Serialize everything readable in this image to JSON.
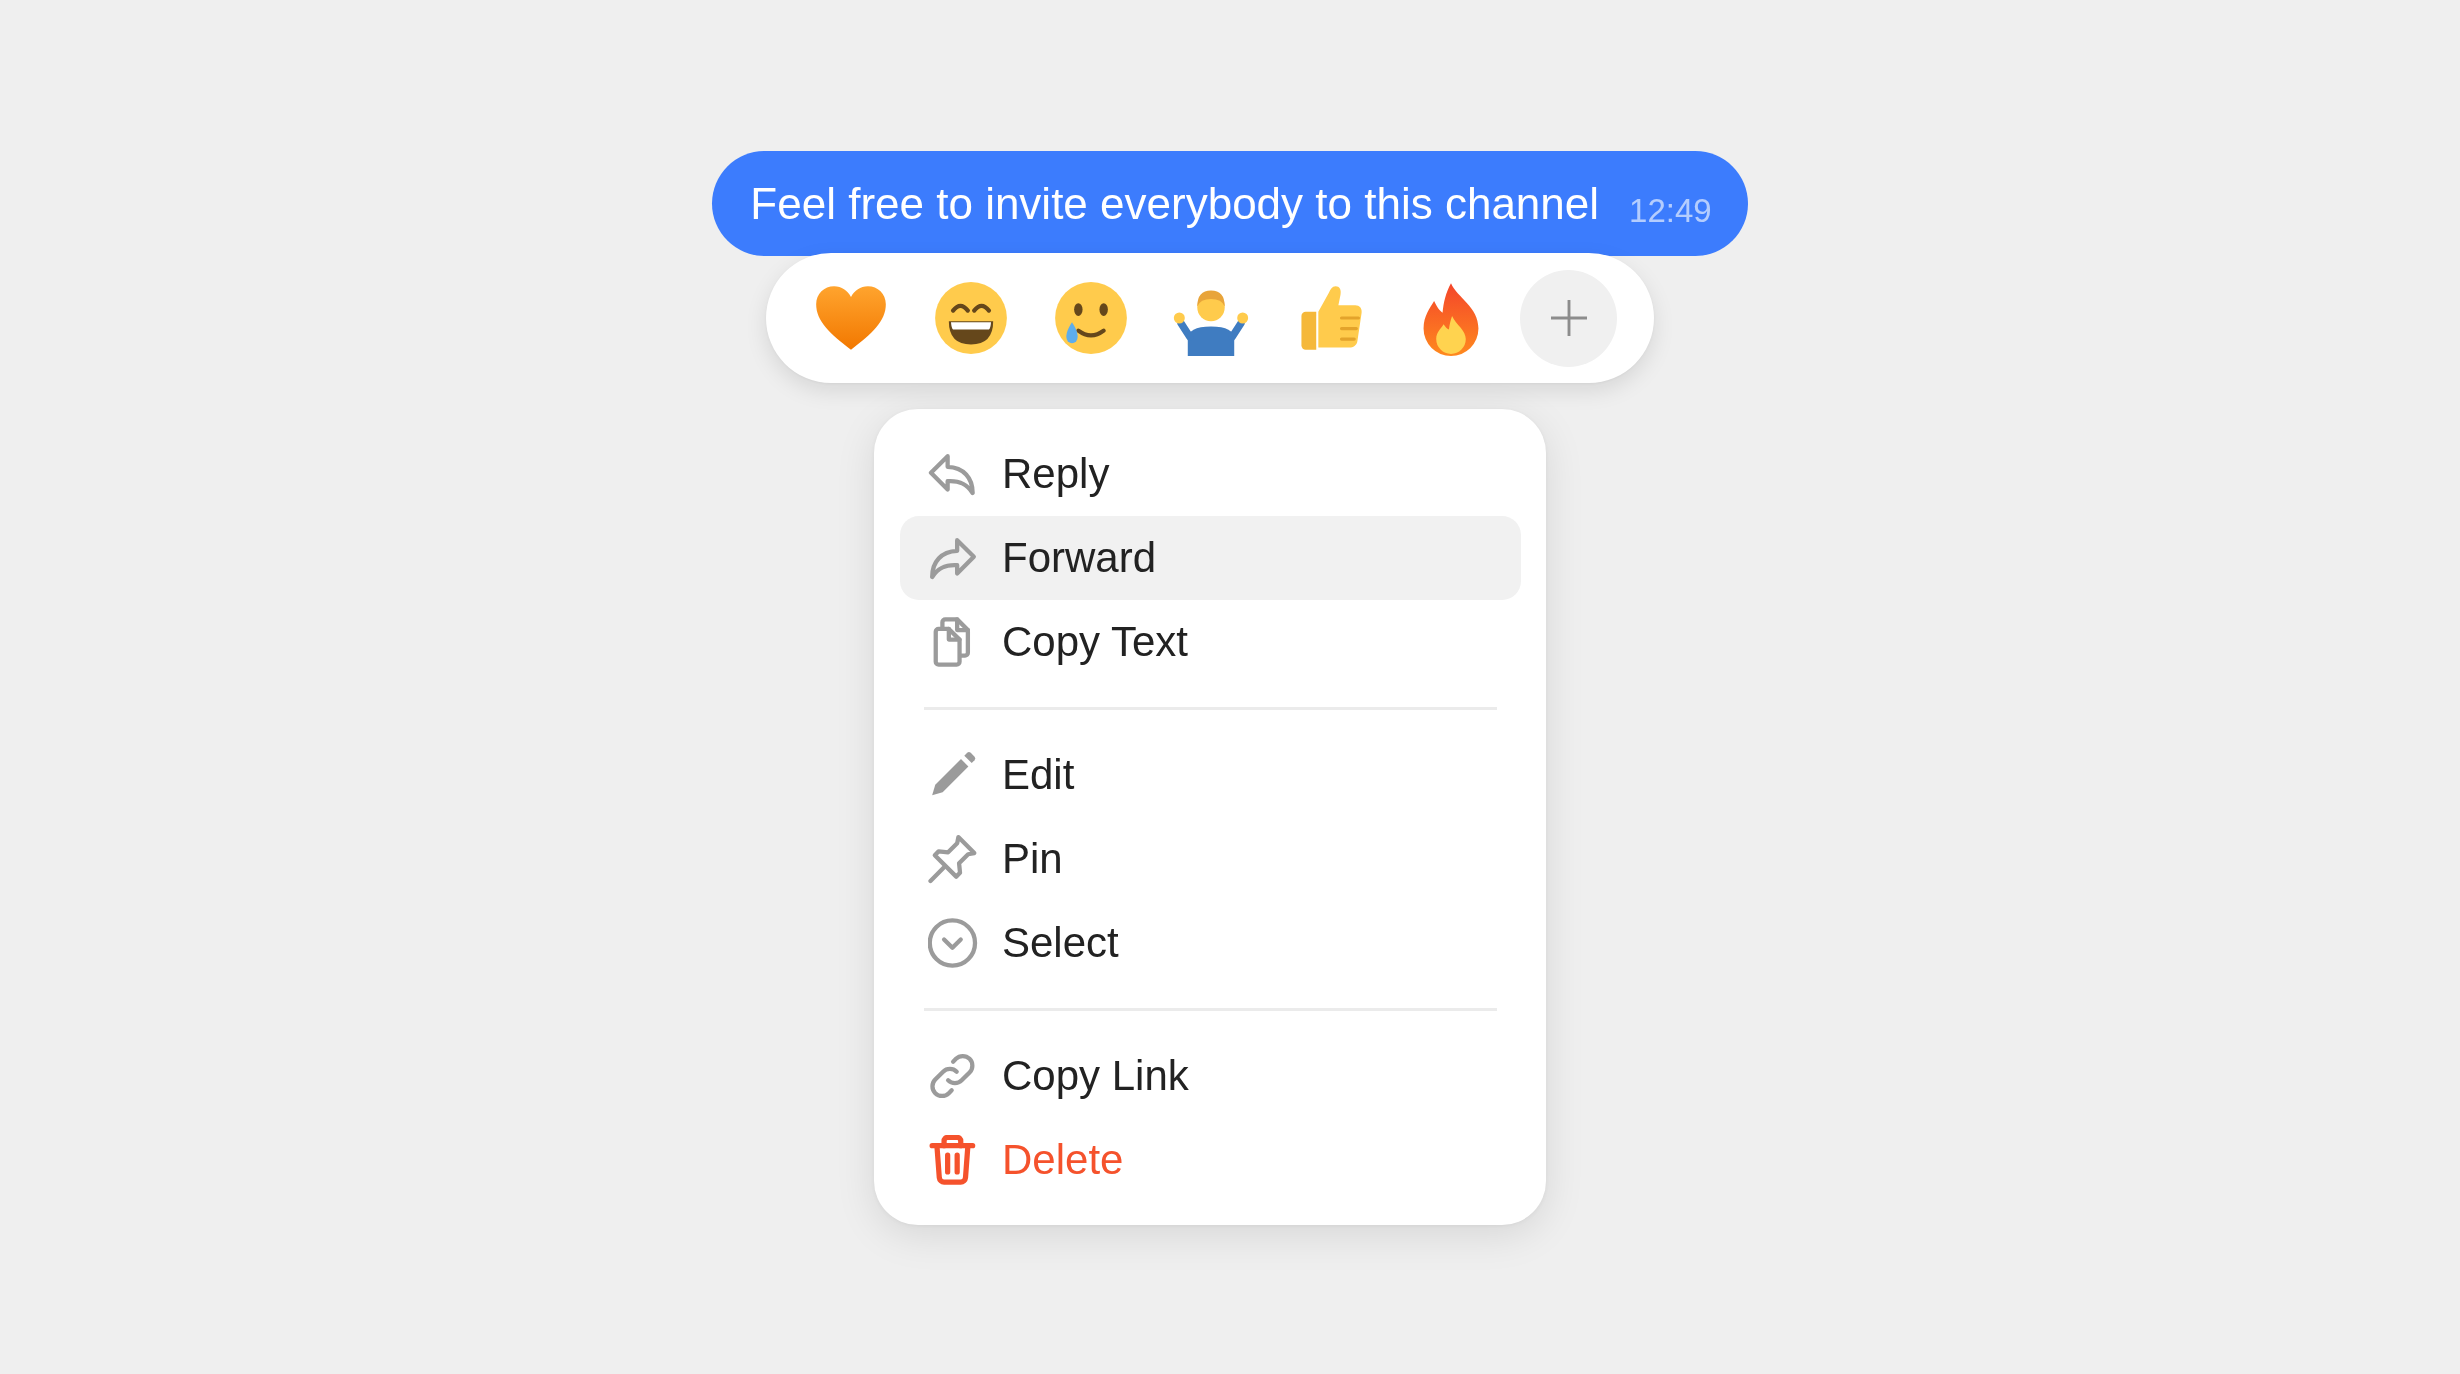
{
  "message": {
    "text": "Feel free to invite everybody to this channel",
    "time": "12:49"
  },
  "reactions": [
    {
      "kind": "heart"
    },
    {
      "kind": "grin"
    },
    {
      "kind": "tearful_smile"
    },
    {
      "kind": "shrug"
    },
    {
      "kind": "thumbs_up"
    },
    {
      "kind": "fire"
    }
  ],
  "menu": {
    "sections": [
      {
        "items": [
          {
            "kind": "reply",
            "label": "Reply",
            "selected": false,
            "destructive": false
          },
          {
            "kind": "forward",
            "label": "Forward",
            "selected": true,
            "destructive": false
          },
          {
            "kind": "copy_text",
            "label": "Copy Text",
            "selected": false,
            "destructive": false
          }
        ]
      },
      {
        "items": [
          {
            "kind": "edit",
            "label": "Edit",
            "selected": false,
            "destructive": false
          },
          {
            "kind": "pin",
            "label": "Pin",
            "selected": false,
            "destructive": false
          },
          {
            "kind": "select",
            "label": "Select",
            "selected": false,
            "destructive": false
          }
        ]
      },
      {
        "items": [
          {
            "kind": "copy_link",
            "label": "Copy Link",
            "selected": false,
            "destructive": false
          },
          {
            "kind": "delete",
            "label": "Delete",
            "selected": false,
            "destructive": true
          }
        ]
      }
    ]
  }
}
